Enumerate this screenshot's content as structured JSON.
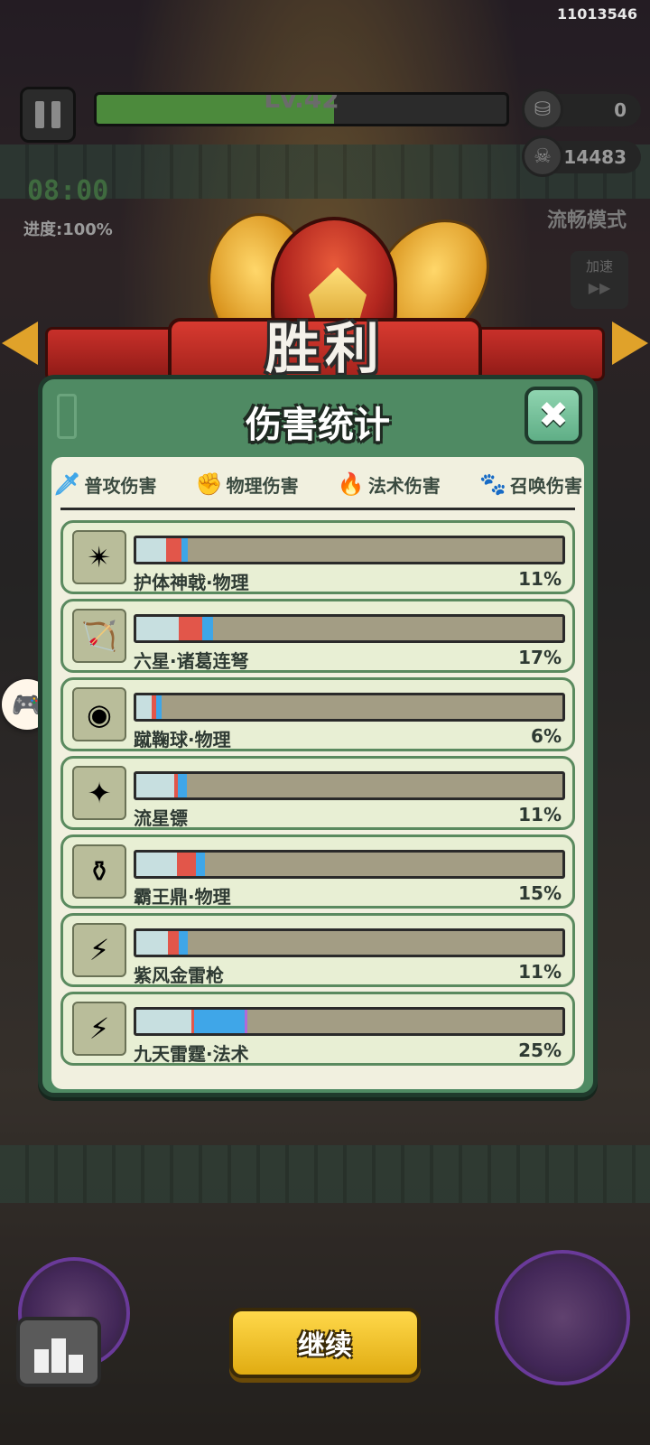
{
  "hud": {
    "player_id": "11013546",
    "level": "Lv.42",
    "xp_fraction": 0.58,
    "coins": "0",
    "kills": "14483",
    "timer": "08:00",
    "progress": "进度:100%",
    "mode": "流畅模式",
    "speed_label": "加速",
    "speed_arrows": "▶▶"
  },
  "victory": {
    "title": "胜利"
  },
  "panel": {
    "title": "伤害统计",
    "close_glyph": "✖",
    "legend": [
      {
        "label": "普攻伤害",
        "icon": "sword-icon",
        "glyph": "🗡",
        "color": "#3fa6e8"
      },
      {
        "label": "物理伤害",
        "icon": "fist-icon",
        "glyph": "✊",
        "color": "#e2564a"
      },
      {
        "label": "法术伤害",
        "icon": "flame-icon",
        "glyph": "🔥",
        "color": "#3fa6e8"
      },
      {
        "label": "召唤伤害",
        "icon": "paw-icon",
        "glyph": "🐾",
        "color": "#b06ad8"
      }
    ],
    "rows": [
      {
        "name": "护体神戟·物理",
        "percent": "11%",
        "icon": "halberd-icon",
        "glyph": "✴",
        "segments": {
          "normal": 0.07,
          "phys": 0.035,
          "magic": 0.015,
          "summon": 0
        }
      },
      {
        "name": "六星·诸葛连弩",
        "percent": "17%",
        "icon": "crossbow-icon",
        "glyph": "🏹",
        "segments": {
          "normal": 0.1,
          "phys": 0.055,
          "magic": 0.025,
          "summon": 0
        }
      },
      {
        "name": "蹴鞠球·物理",
        "percent": "6%",
        "icon": "ball-icon",
        "glyph": "◉",
        "segments": {
          "normal": 0.035,
          "phys": 0.012,
          "magic": 0.013,
          "summon": 0
        }
      },
      {
        "name": "流星镖",
        "percent": "11%",
        "icon": "shuriken-icon",
        "glyph": "✦",
        "segments": {
          "normal": 0.09,
          "phys": 0.008,
          "magic": 0.02,
          "summon": 0
        }
      },
      {
        "name": "霸王鼎·物理",
        "percent": "15%",
        "icon": "cauldron-icon",
        "glyph": "⚱",
        "segments": {
          "normal": 0.095,
          "phys": 0.045,
          "magic": 0.02,
          "summon": 0
        }
      },
      {
        "name": "紫风金雷枪",
        "percent": "11%",
        "icon": "spear-icon",
        "glyph": "⚡",
        "segments": {
          "normal": 0.075,
          "phys": 0.025,
          "magic": 0.02,
          "summon": 0
        }
      },
      {
        "name": "九天雷霆·法术",
        "percent": "25%",
        "icon": "thunder-icon",
        "glyph": "⚡",
        "segments": {
          "normal": 0.13,
          "phys": 0.005,
          "magic": 0.12,
          "summon": 0.005
        }
      }
    ]
  },
  "bottom": {
    "continue_label": "继续"
  },
  "colors": {
    "panel_green": "#4f8a63",
    "physical_red": "#e2564a",
    "magic_blue": "#3fa6e8",
    "summon_purple": "#b06ad8",
    "continue_yellow": "#ffd84a"
  }
}
